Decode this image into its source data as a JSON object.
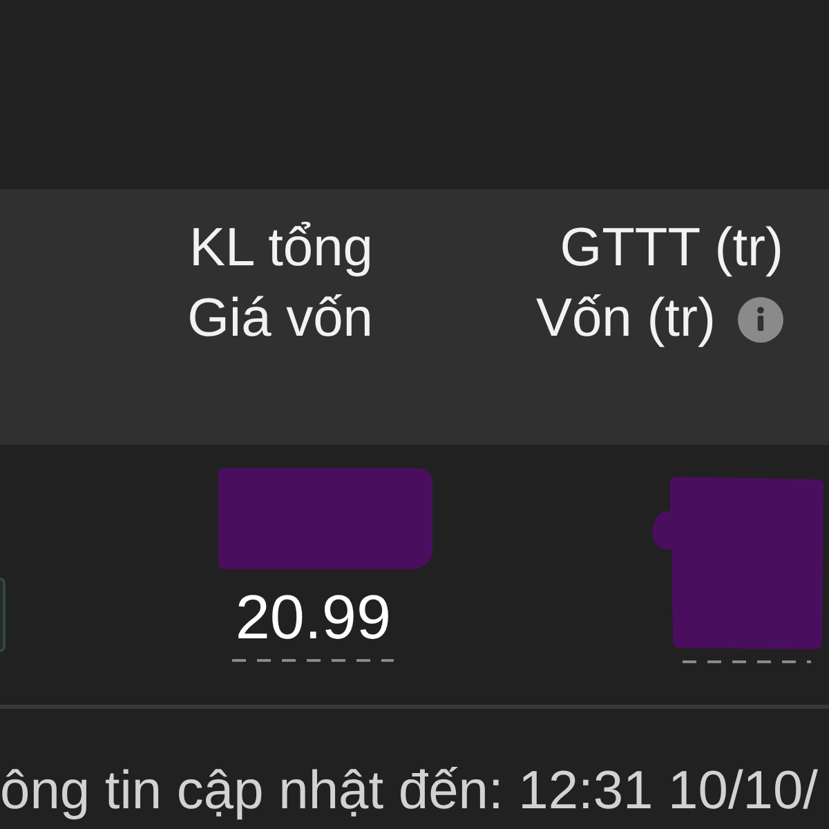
{
  "table": {
    "columns": [
      {
        "title": "KL tổng",
        "subtitle": "Giá vốn",
        "info_icon": false
      },
      {
        "title": "GTTT (tr)",
        "subtitle": "Vốn (tr)",
        "info_icon": true
      }
    ],
    "rows": [
      {
        "cells": [
          {
            "kind": "partly_hidden",
            "value": "20.99"
          },
          {
            "kind": "hidden"
          }
        ]
      }
    ]
  },
  "footer": {
    "update_note": "ông tin cập nhật đến: 12:31 10/10/"
  }
}
